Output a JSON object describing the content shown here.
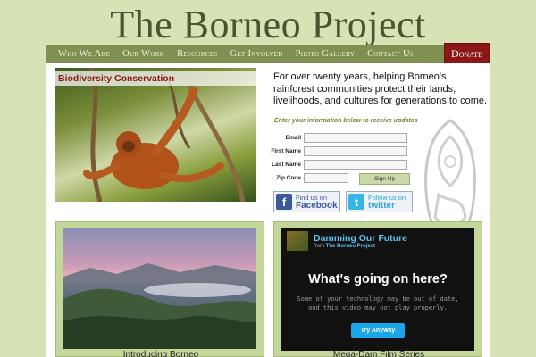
{
  "site": {
    "title": "The Borneo Project"
  },
  "nav": {
    "items": [
      "Who We Are",
      "Our Work",
      "Resources",
      "Get Involved",
      "Photo Gallery",
      "Contact Us"
    ],
    "donate": "Donate"
  },
  "feature": {
    "caption": "Biodiversity Conservation"
  },
  "intro": {
    "text": "For over twenty years, helping Borneo's rainforest communities protect their lands, livelihoods, and cultures for generations to come.",
    "prompt": "Enter your information below to receive updates"
  },
  "signup_form": {
    "fields": [
      "Email",
      "First Name",
      "Last Name",
      "Zip Code"
    ],
    "button": "Sign Up"
  },
  "social": {
    "facebook": {
      "line1": "Find us on",
      "line2": "Facebook",
      "glyph": "f"
    },
    "twitter": {
      "line1": "Follow us on",
      "line2": "twitter",
      "glyph": "t"
    }
  },
  "panels": {
    "left": {
      "label": "Introducing Borneo"
    },
    "right": {
      "label": "Mega-Dam Film Series",
      "video": {
        "title": "Damming Our Future",
        "from_prefix": "from",
        "from_name": "The Borneo Project",
        "question": "What's going on here?",
        "note_line1": "Some of your technology may be out of date,",
        "note_line2": "and this video may not play properly.",
        "button": "Try Anyway"
      }
    }
  }
}
